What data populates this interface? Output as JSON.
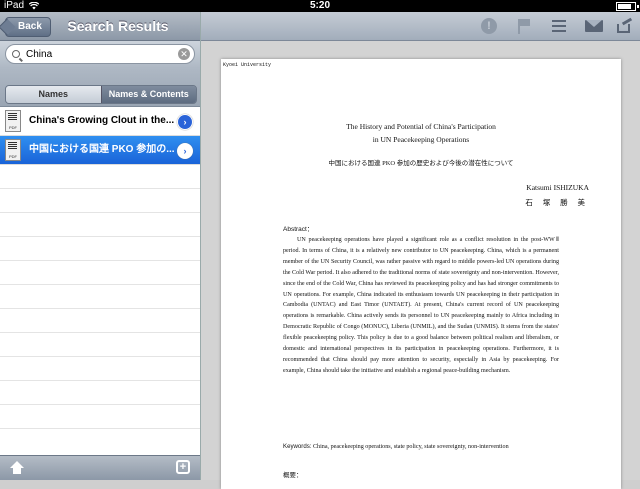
{
  "status_bar": {
    "carrier": "iPad",
    "time": "5:20"
  },
  "sidebar": {
    "back_label": "Back",
    "title": "Search Results",
    "search": {
      "value": "China"
    },
    "scope": {
      "names": "Names",
      "names_contents": "Names & Contents",
      "selected": "Names & Contents"
    },
    "results": [
      {
        "title": "China's Growing Clout in the...",
        "icon": "pdf-icon",
        "icon_label": "PDF",
        "selected": false
      },
      {
        "title": "中国における国連 PKO 参加の...",
        "icon": "pdf-icon",
        "icon_label": "PDF",
        "selected": true
      }
    ]
  },
  "toolbar": {
    "icons": [
      "alert-icon",
      "flag-icon",
      "menu-icon",
      "mail-icon",
      "share-icon"
    ]
  },
  "document": {
    "university": "Kyoei University",
    "title_line1": "The History and Potential of China's Participation",
    "title_line2": "in UN Peacekeeping Operations",
    "jp_title": "中国における国連 PKO 参加の歴史および今後の潜在性について",
    "author": "Katsumi ISHIZUKA",
    "author_jp": "石 塚 勝 美",
    "abstract_heading": "Abstract：",
    "abstract": "UN peacekeeping operations have played a significant role as a conflict resolution in the post-WWⅡ period. In terms of China, it is a relatively new contributor to UN peacekeeping. China, which is a permanent member of the UN Security Council, was rather passive with regard to middle powers-led UN operations during the Cold War period. It also adhered to the traditional norms of state sovereignty and non-intervention. However, since the end of the Cold War, China has reviewed its peacekeeping policy and has had stronger commitments to UN operations. For example, China indicated its enthusiasm towards UN peacekeeping in their participation in Cambodia (UNTAC) and East Timor (UNTAET). At present, China's current record of UN peacekeeping operations is remarkable. China actively sends its personnel to UN peacekeeping mainly to Africa including in Democratic Republic of Congo (MONUC), Liberia (UNMIL), and the Sudan (UNMIS). It stems from the states' flexible peacekeeping policy. This policy is due to a good balance between political realism and liberalism, or domestic and international perspectives in its participation in peacekeeping operations. Furthermore, it is recommended that China should pay more attention to security, especially in Asia by peacekeeping. For example, China should take the initiative and establish a regional peace-building mechanism.",
    "keywords_label": "Keywords:",
    "keywords": "China, peacekeeping operations, state policy, state sovereignty, non-intervention",
    "gaiyou": "概要："
  }
}
